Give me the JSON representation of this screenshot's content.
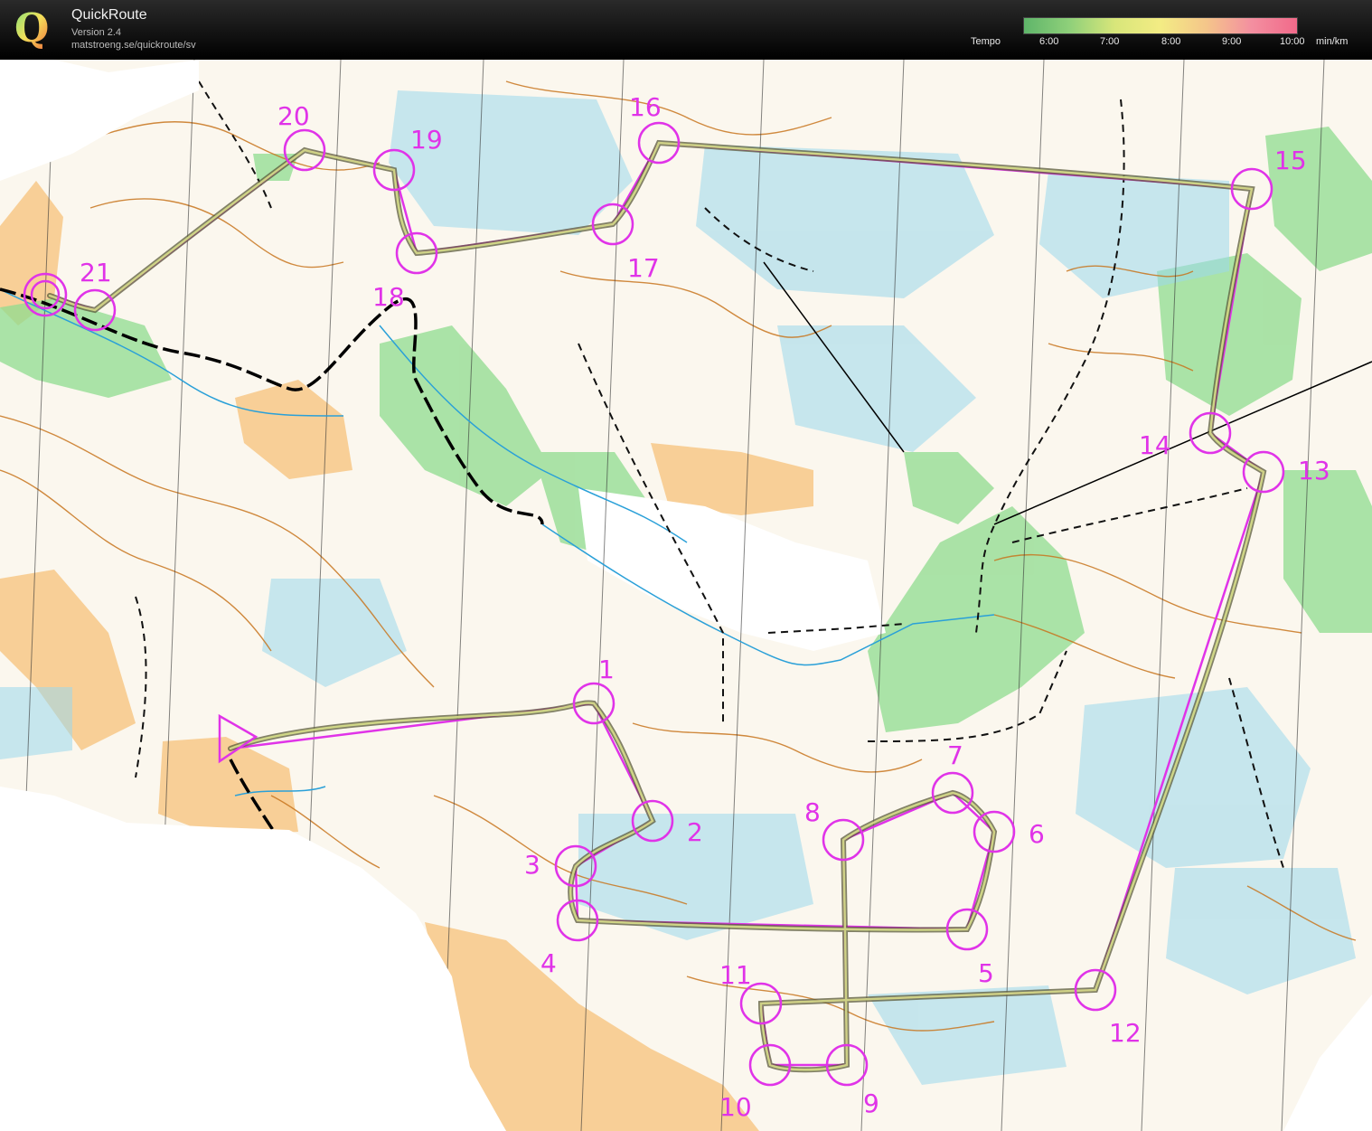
{
  "header": {
    "logo_letter": "Q",
    "app_title": "QuickRoute",
    "version": "Version 2.4",
    "url": "matstroeng.se/quickroute/sv"
  },
  "legend": {
    "label": "Tempo",
    "ticks": [
      "6:00",
      "7:00",
      "8:00",
      "9:00",
      "10:00"
    ],
    "unit": "min/km"
  },
  "colors": {
    "course": "#e033e8",
    "route": "#6b6b3a",
    "vegetation_green": "#8fdc8f",
    "marsh_blue": "#7fd0e8",
    "contour_brown": "#c8751e",
    "open_yellow": "#f7c27a"
  },
  "course": {
    "controls": [
      {
        "number": "1"
      },
      {
        "number": "2"
      },
      {
        "number": "3"
      },
      {
        "number": "4"
      },
      {
        "number": "5"
      },
      {
        "number": "6"
      },
      {
        "number": "7"
      },
      {
        "number": "8"
      },
      {
        "number": "9"
      },
      {
        "number": "10"
      },
      {
        "number": "11"
      },
      {
        "number": "12"
      },
      {
        "number": "13"
      },
      {
        "number": "14"
      },
      {
        "number": "15"
      },
      {
        "number": "16"
      },
      {
        "number": "17"
      },
      {
        "number": "18"
      },
      {
        "number": "19"
      },
      {
        "number": "20"
      },
      {
        "number": "21"
      }
    ]
  }
}
